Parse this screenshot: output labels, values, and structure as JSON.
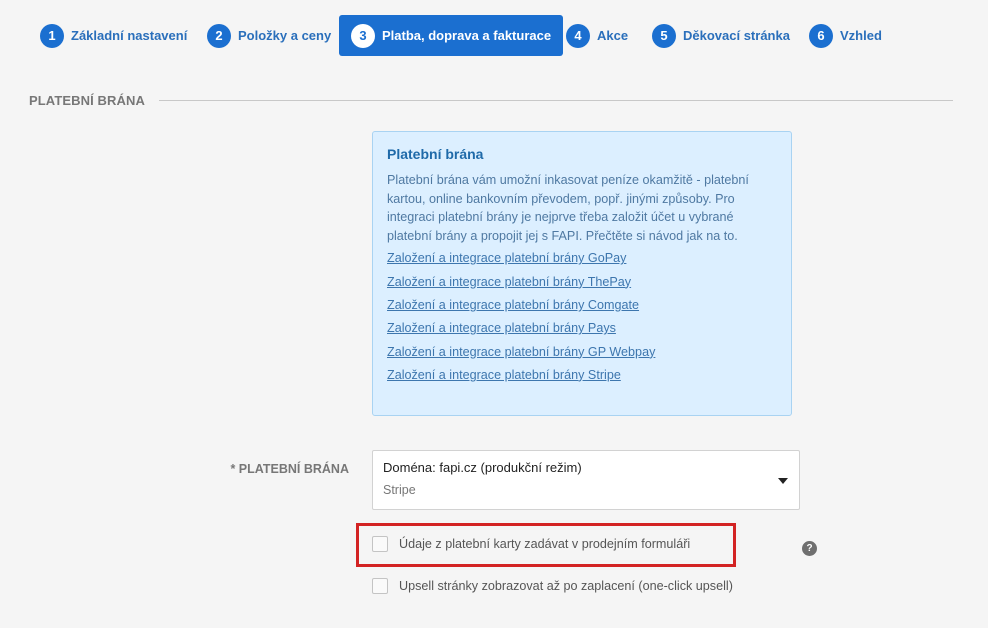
{
  "steps": [
    {
      "num": "1",
      "label": "Základní nastavení"
    },
    {
      "num": "2",
      "label": "Položky a ceny"
    },
    {
      "num": "3",
      "label": "Platba, doprava a fakturace",
      "active": true
    },
    {
      "num": "4",
      "label": "Akce"
    },
    {
      "num": "5",
      "label": "Děkovací stránka"
    },
    {
      "num": "6",
      "label": "Vzhled"
    }
  ],
  "section": {
    "title": "PLATEBNÍ BRÁNA"
  },
  "info": {
    "title": "Platební brána",
    "text": "Platební brána vám umožní inkasovat peníze okamžitě - platební kartou, online bankovním převodem, popř. jinými způsoby. Pro integraci platební brány je nejprve třeba založit účet u vybrané platební brány a propojit jej s FAPI. Přečtěte si návod jak na to.",
    "links": [
      "Založení a integrace platební brány GoPay",
      "Založení a integrace platební brány ThePay",
      "Založení a integrace platební brány Comgate",
      "Založení a integrace platební brány Pays",
      "Založení a integrace platební brány GP Webpay",
      "Založení a integrace platební brány Stripe"
    ]
  },
  "gateway_field": {
    "label": "* PLATEBNÍ BRÁNA",
    "selected_line1": "Doména: fapi.cz (produkční režim)",
    "selected_line2": "Stripe"
  },
  "checkboxes": [
    {
      "label": "Údaje z platební karty zadávat v prodejním formuláři",
      "checked": false
    },
    {
      "label": "Upsell stránky zobrazovat až po zaplacení (one-click upsell)",
      "checked": false
    }
  ],
  "help_icon": {
    "glyph": "?"
  },
  "colors": {
    "accent": "#1b6fd0",
    "info_bg": "#dcefff",
    "highlight": "#d32323"
  }
}
